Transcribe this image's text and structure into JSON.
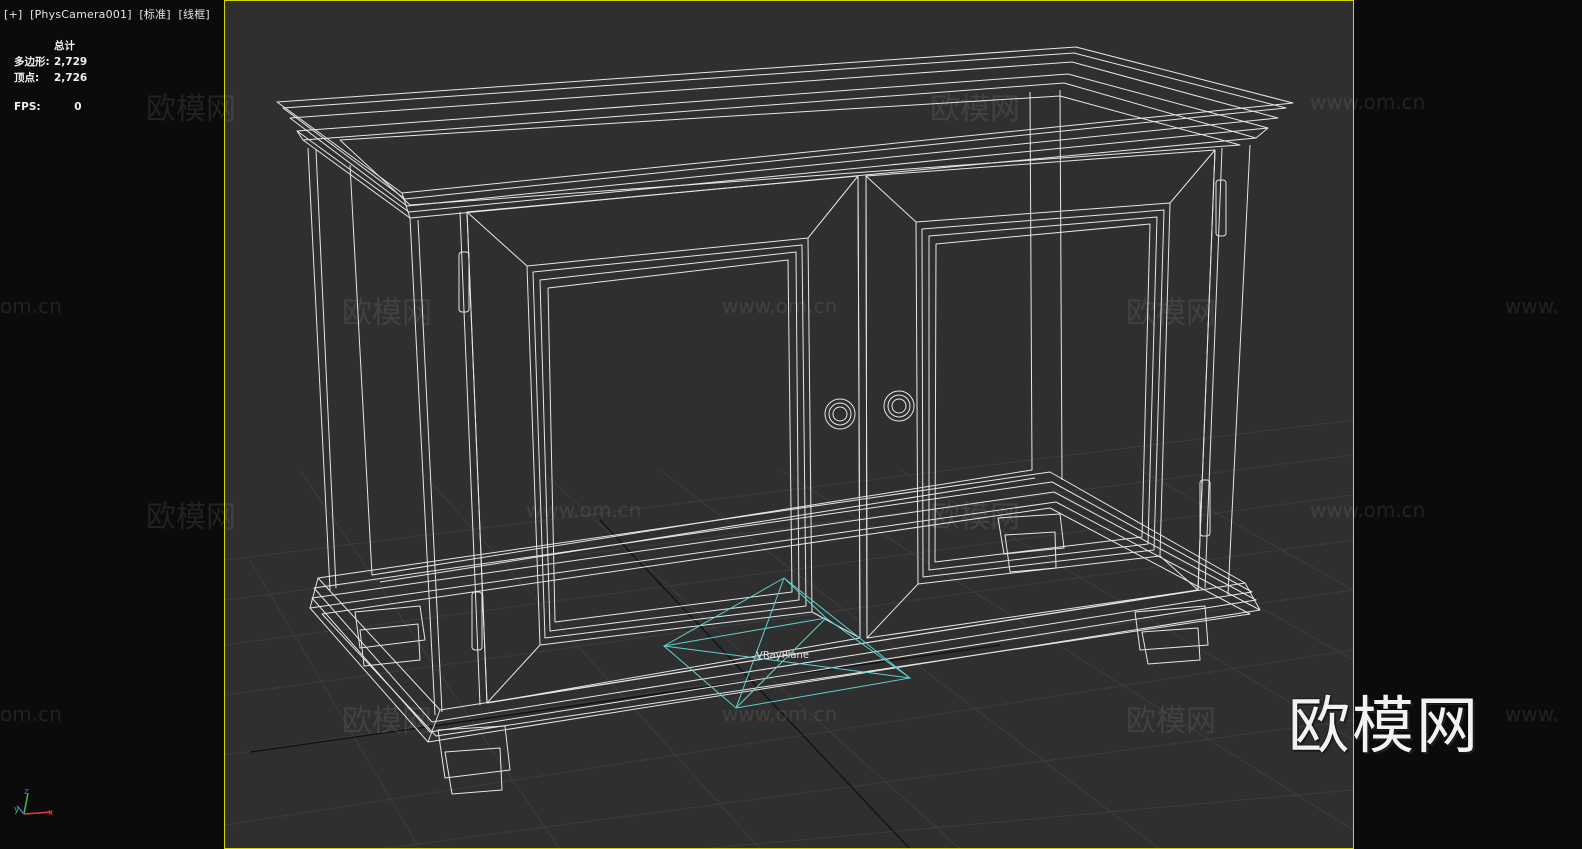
{
  "viewport": {
    "label_plus": "[+]",
    "label_camera": "[PhysCamera001]",
    "label_shading_std": "[标准]",
    "label_shading_wire": "[线框]"
  },
  "stats": {
    "header": "总计",
    "polys_label": "多边形:",
    "polys_value": "2,729",
    "verts_label": "顶点:",
    "verts_value": "2,726",
    "fps_label": "FPS:",
    "fps_value": "0"
  },
  "scene": {
    "object_label": "VRayPlane"
  },
  "watermarks": {
    "brand_cn": "欧模网",
    "url": "www.om.cn",
    "url_short": "om.cn",
    "url_prefix": "www."
  },
  "axis": {
    "x": "x",
    "y": "y",
    "z": "z"
  },
  "colors": {
    "viewport_bg": "#2f2f2f",
    "frame": "#d4d400",
    "wire": "#e6e6e6",
    "plane": "#5fd0d0",
    "grid": "#3f3f3f"
  }
}
